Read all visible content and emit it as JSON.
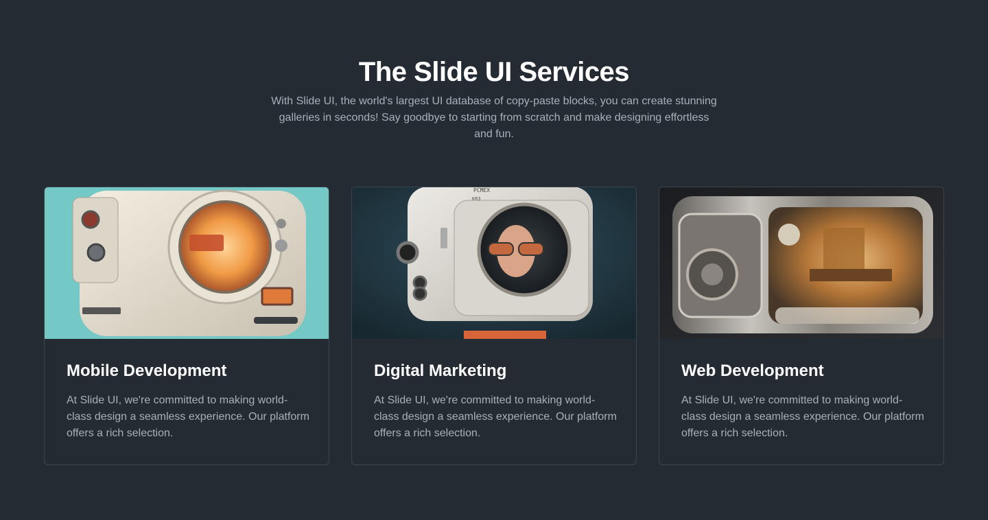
{
  "section": {
    "heading": "The Slide UI Services",
    "subtitle": "With Slide UI, the world's largest UI database of copy-paste blocks, you can create stunning galleries in seconds! Say goodbye to starting from scratch and make designing effortless and fun."
  },
  "cards": [
    {
      "title": "Mobile Development",
      "text": "At Slide UI, we're committed to making world-class design a seamless experience. Our platform offers a rich selection.",
      "image": "retro-appliance-robot-teal"
    },
    {
      "title": "Digital Marketing",
      "text": "At Slide UI, we're committed to making world-class design a seamless experience. Our platform offers a rich selection.",
      "image": "retro-tv-robot-face",
      "image_label_lines": [
        "PCMEX",
        "KR3"
      ]
    },
    {
      "title": "Web Development",
      "text": "At Slide UI, we're committed to making world-class design a seamless experience. Our platform offers a rich selection.",
      "image": "chrome-machine-glass"
    }
  ],
  "colors": {
    "background": "#252b33",
    "card_border": "#3d444e",
    "muted_text": "#a8b0bb",
    "teal": "#6fc3c1"
  }
}
